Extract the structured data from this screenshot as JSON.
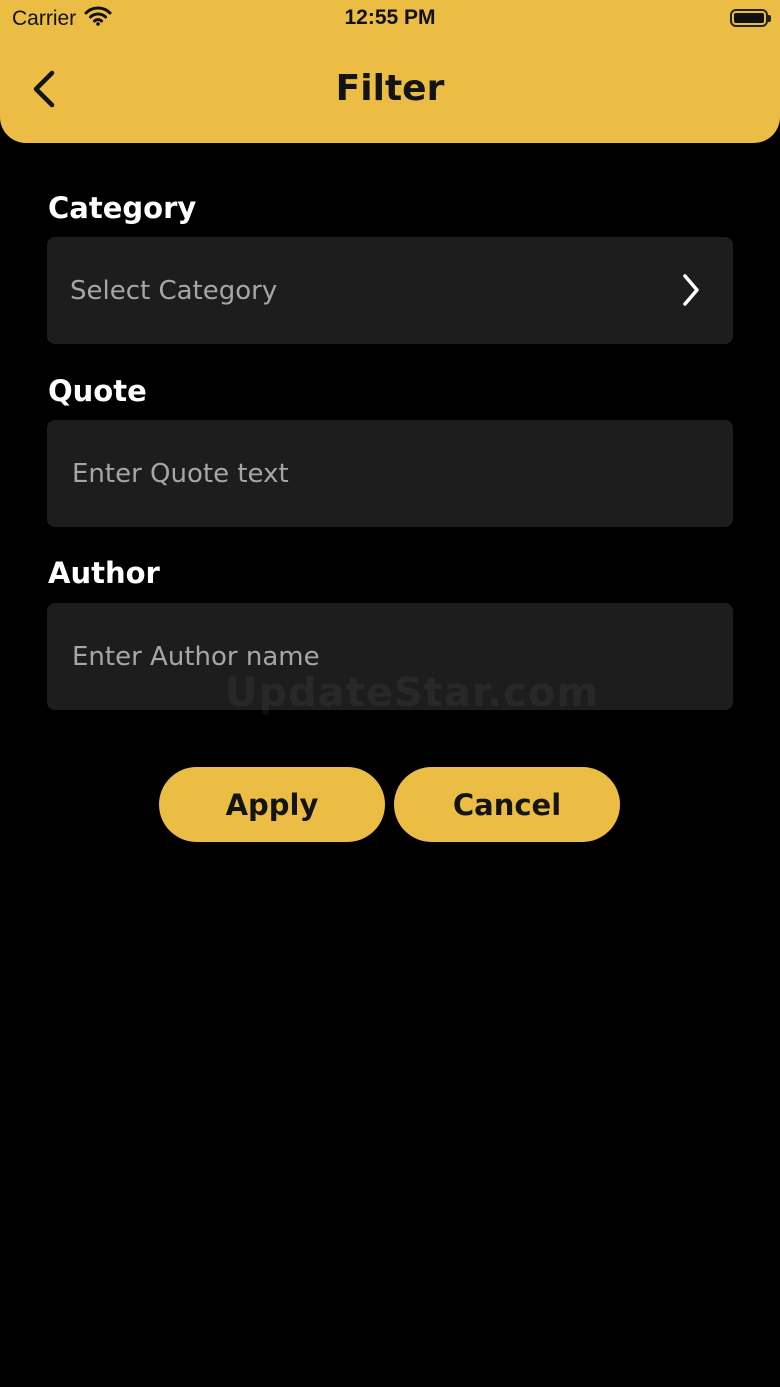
{
  "status_bar": {
    "carrier": "Carrier",
    "time": "12:55 PM",
    "wifi_icon": "wifi-icon",
    "battery_icon": "battery-icon"
  },
  "nav": {
    "title": "Filter",
    "back_icon": "chevron-left-icon"
  },
  "form": {
    "category": {
      "label": "Category",
      "placeholder": "Select Category",
      "icon": "chevron-right-icon"
    },
    "quote": {
      "label": "Quote",
      "placeholder": "Enter Quote text",
      "value": ""
    },
    "author": {
      "label": "Author",
      "placeholder": "Enter Author name",
      "value": ""
    }
  },
  "watermark": "UpdateStar.com",
  "buttons": {
    "apply": "Apply",
    "cancel": "Cancel"
  },
  "colors": {
    "accent": "#ebbd45",
    "background": "#000000",
    "field_background": "#1d1d1d",
    "placeholder": "#a6a6a6"
  }
}
